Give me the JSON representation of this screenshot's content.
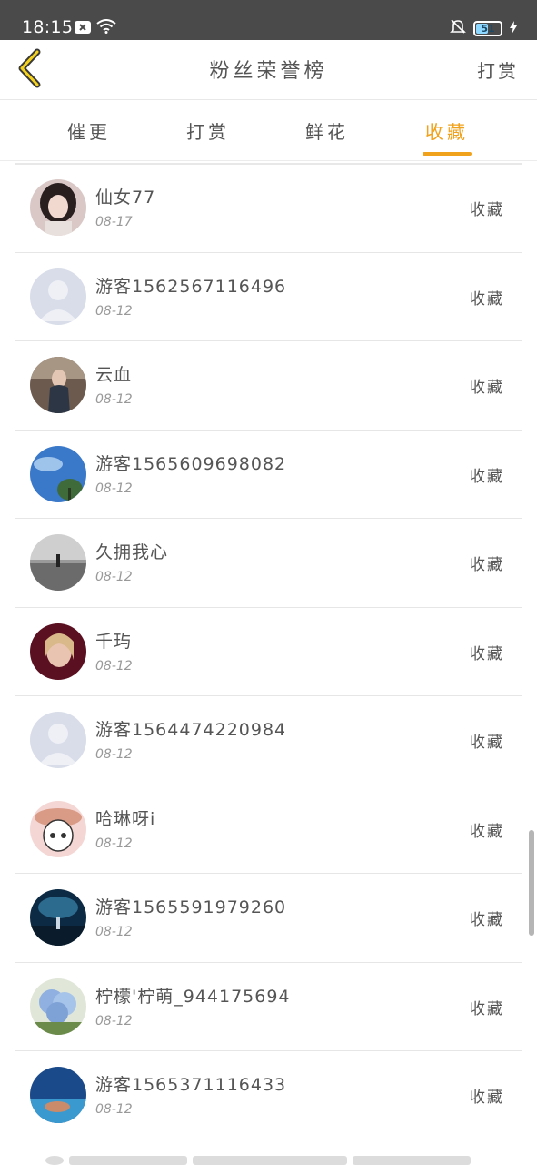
{
  "status_bar": {
    "time": "18:15",
    "battery": "51",
    "battery_level": 0.51,
    "icons": [
      "notification-x-icon",
      "wifi-icon",
      "mute-bell-icon",
      "battery-icon",
      "charging-icon"
    ]
  },
  "header": {
    "title": "粉丝荣誉榜",
    "action": "打赏",
    "back_icon": "chevron-left-icon"
  },
  "tabs": [
    {
      "label": "催更",
      "active": false
    },
    {
      "label": "打赏",
      "active": false
    },
    {
      "label": "鲜花",
      "active": false
    },
    {
      "label": "收藏",
      "active": true
    }
  ],
  "colors": {
    "accent": "#f0a21c",
    "status_bar": "#4a4a4a",
    "text": "#555555",
    "subtext": "#999999"
  },
  "items": [
    {
      "name": "仙女77",
      "date": "08-17",
      "action": "收藏",
      "avatar": "photo-girl"
    },
    {
      "name": "游客1562567116496",
      "date": "08-12",
      "action": "收藏",
      "avatar": "default-user"
    },
    {
      "name": "云血",
      "date": "08-12",
      "action": "收藏",
      "avatar": "photo-dark"
    },
    {
      "name": "游客1565609698082",
      "date": "08-12",
      "action": "收藏",
      "avatar": "photo-sky"
    },
    {
      "name": "久拥我心",
      "date": "08-12",
      "action": "收藏",
      "avatar": "photo-beach"
    },
    {
      "name": "千玙",
      "date": "08-12",
      "action": "收藏",
      "avatar": "photo-portrait"
    },
    {
      "name": "游客1564474220984",
      "date": "08-12",
      "action": "收藏",
      "avatar": "default-user"
    },
    {
      "name": "哈琳呀i",
      "date": "08-12",
      "action": "收藏",
      "avatar": "cartoon"
    },
    {
      "name": "游客1565591979260",
      "date": "08-12",
      "action": "收藏",
      "avatar": "photo-night"
    },
    {
      "name": "柠檬'柠萌_944175694",
      "date": "08-12",
      "action": "收藏",
      "avatar": "photo-flowers"
    },
    {
      "name": "游客1565371116433",
      "date": "08-12",
      "action": "收藏",
      "avatar": "photo-underwater"
    }
  ]
}
